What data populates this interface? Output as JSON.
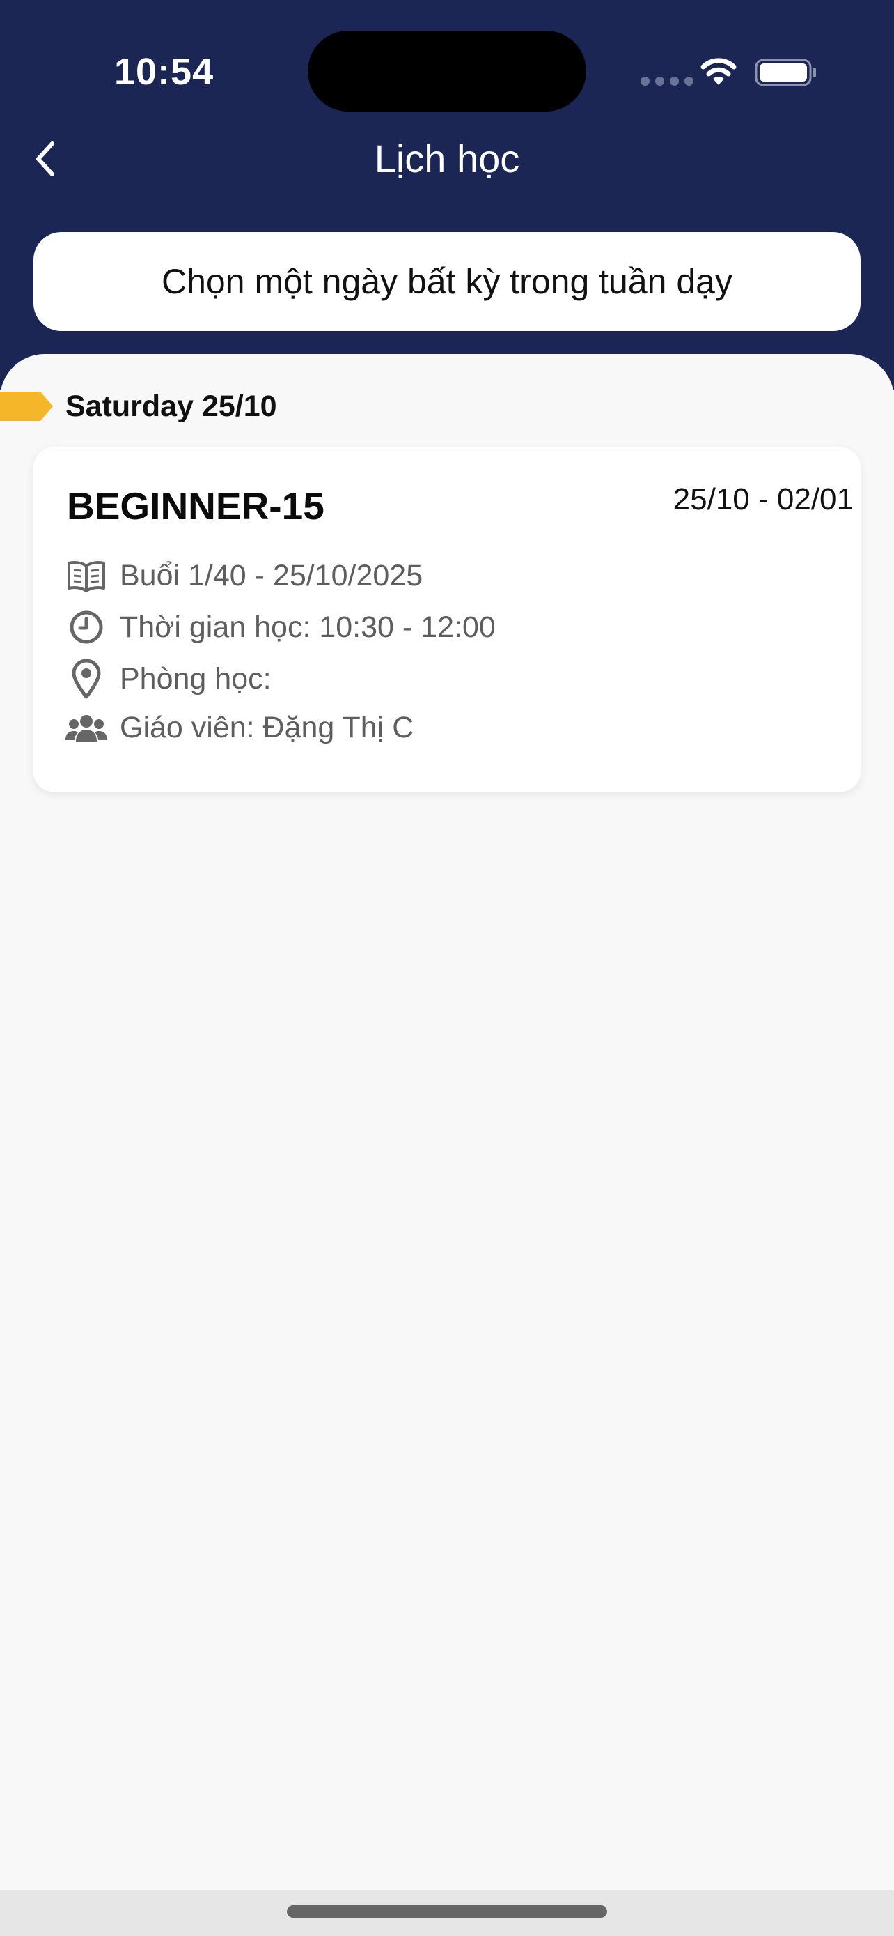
{
  "status_bar": {
    "time": "10:54"
  },
  "header": {
    "title": "Lịch học",
    "back_icon": "chevron-left-icon"
  },
  "week_selector": {
    "label": "Chọn một ngày bất kỳ trong tuần dạy"
  },
  "schedule": {
    "day_label": "Saturday 25/10",
    "cards": [
      {
        "class_name": "BEGINNER-15",
        "date_range": "25/10 - 02/01",
        "session": "Buổi 1/40 - 25/10/2025",
        "time": "Thời gian học: 10:30 - 12:00",
        "room": "Phòng học:",
        "teacher": "Giáo viên: Đặng Thị C"
      }
    ]
  },
  "colors": {
    "header_bg": "#1b2654",
    "accent": "#f5b62a",
    "sheet_bg": "#f8f8f8"
  }
}
